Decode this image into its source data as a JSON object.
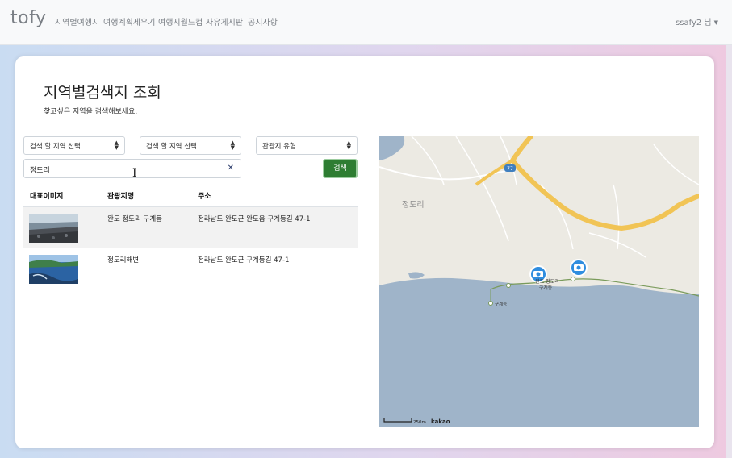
{
  "nav": {
    "brand": "tofy",
    "items": [
      "지역별여행지",
      "여행계획세우기",
      "여행지월드컵",
      "자유게시판",
      "공지사항"
    ],
    "user": "ssafy2 님"
  },
  "page": {
    "title": "지역별검색지 조회",
    "subtitle": "찾고싶은 지역을 검색해보세요."
  },
  "filters": {
    "sido": "검색 할 지역 선택",
    "gugun": "검색 할 지역 선택",
    "content_type": "관광지 유형"
  },
  "search": {
    "value": "정도리",
    "button": "검색"
  },
  "table": {
    "headers": [
      "대표이미지",
      "관광지명",
      "주소"
    ],
    "rows": [
      {
        "name": "완도 정도리 구계등",
        "address": "전라남도 완도군 완도읍 구계등길 47-1"
      },
      {
        "name": "정도리해변",
        "address": "전라남도 완도군 구계등길 47-1"
      }
    ]
  },
  "map": {
    "place_label": "정도리",
    "road_badge": "77",
    "marker_label_line1": "완도 정도리",
    "marker_label_line2": "구계등",
    "small_label": "구계등",
    "scale": "250m",
    "provider": "kakao"
  },
  "colors": {
    "primary_button": "#2e7d32",
    "sea": "#9fb4c9",
    "land": "#eceae3",
    "road": "#f1c455",
    "marker": "#2f8ddf"
  }
}
